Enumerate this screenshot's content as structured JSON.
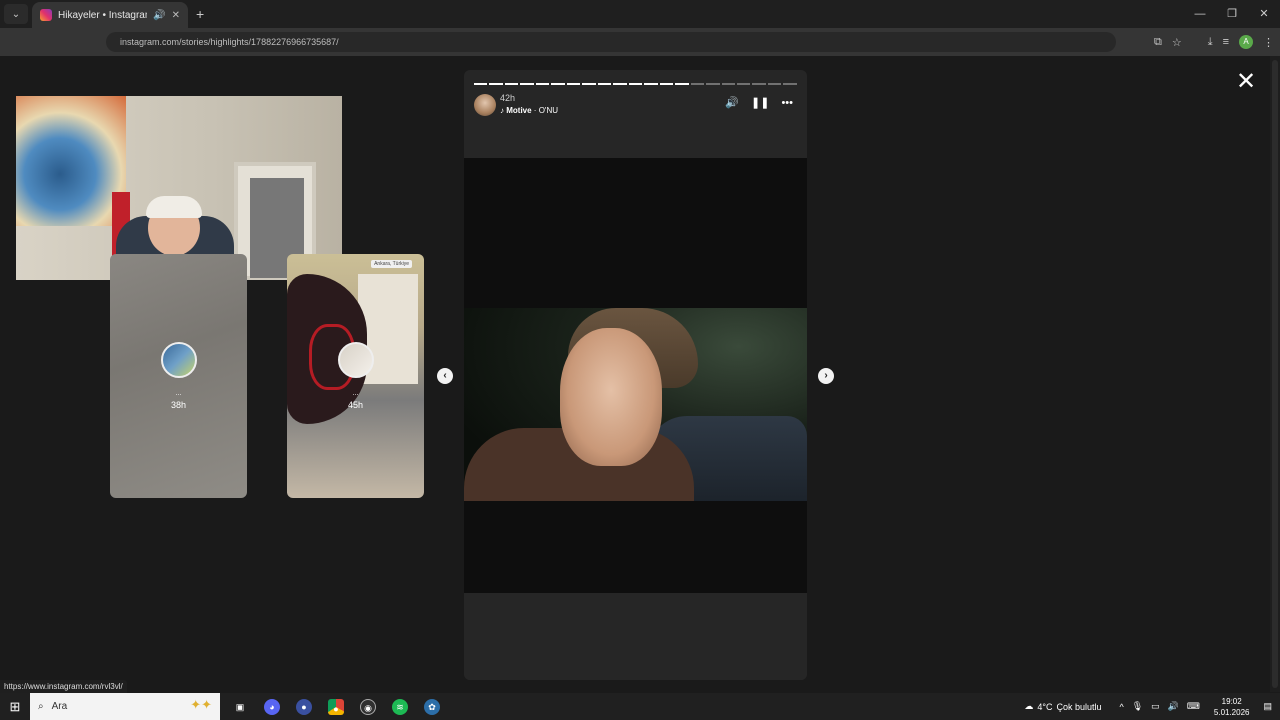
{
  "browser": {
    "tab_title": "Hikayeler • Instagram",
    "url": "instagram.com/stories/highlights/17882276966735687/",
    "new_tab": "+",
    "window_controls": [
      "—",
      "❐",
      "✕"
    ]
  },
  "page": {
    "close_symbol": "✕",
    "prev_arrow": "‹",
    "next_arrow": "›"
  },
  "previews": [
    {
      "name": "...",
      "time": "38h"
    },
    {
      "name": "...",
      "time": "45h",
      "location": "Ankara, Türkiye"
    }
  ],
  "story": {
    "time": "42h",
    "music_artist": "Motive",
    "music_song": "O'NU",
    "progress_total": 21,
    "progress_done": 14
  },
  "status_url": "https://www.instagram.com/rvl3vl/",
  "taskbar": {
    "search_label": "Ara",
    "weather_temp": "4°C",
    "weather_desc": "Çok bulutlu",
    "time": "19:02",
    "date": "5.01.2026"
  }
}
